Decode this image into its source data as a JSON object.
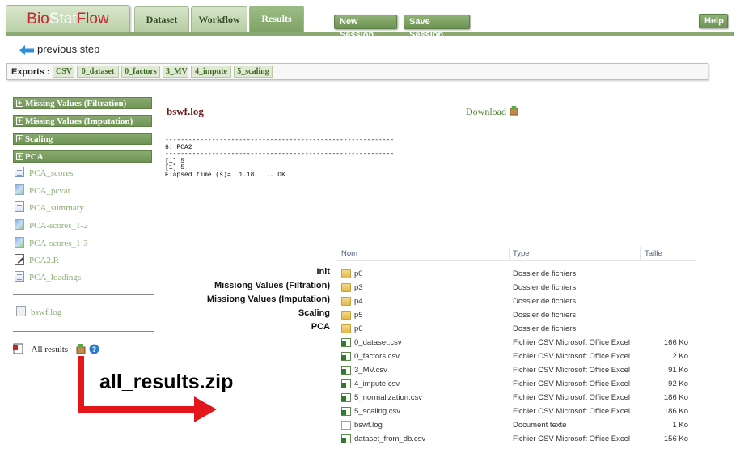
{
  "app": {
    "logo_part1": "Bio",
    "logo_part2": "Stat",
    "logo_part3": "Flow"
  },
  "tabs": {
    "dataset": "Dataset",
    "workflow": "Workflow",
    "results": "Results"
  },
  "header_buttons": {
    "new_session": "New Session",
    "save_session": "Save Session",
    "help": "Help"
  },
  "nav": {
    "previous_step": "previous step"
  },
  "exports": {
    "label": "Exports :",
    "links": [
      "CSV",
      "0_dataset",
      "0_factors",
      "3_MV",
      "4_impute",
      "5_scaling"
    ]
  },
  "sidebar": {
    "sections": [
      "Missing Values (Filtration)",
      "Missing Values (Imputation)",
      "Scaling",
      "PCA"
    ],
    "pca_items": [
      "PCA_scores",
      "PCA_pcvar",
      "PCA_summary",
      "PCA-scores_1-2",
      "PCA-scores_1-3",
      "PCA2.R",
      "PCA_loadings"
    ],
    "log_item": "bswf.log",
    "all_results": "- All results"
  },
  "content": {
    "file_title": "bswf.log",
    "download": "Download",
    "log_lines": [
      "-----------------------------------------------------------",
      "6: PCA2",
      "-----------------------------------------------------------",
      "[1] 5",
      "[1] 5",
      "Elapsed time (s)=  1.18  ... OK"
    ]
  },
  "annotation": {
    "big_label": "all_results.zip",
    "arrow_color": "#e3161b"
  },
  "step_labels": [
    "Init",
    "Missiong Values (Filtration)",
    "Missiong Values (Imputation)",
    "Scaling",
    "PCA"
  ],
  "explorer": {
    "headers": {
      "name": "Nom",
      "type": "Type",
      "size": "Taille"
    },
    "rows": [
      {
        "name": "p0",
        "type": "Dossier de fichiers",
        "size": "",
        "icon": "folder"
      },
      {
        "name": "p3",
        "type": "Dossier de fichiers",
        "size": "",
        "icon": "folder"
      },
      {
        "name": "p4",
        "type": "Dossier de fichiers",
        "size": "",
        "icon": "folder"
      },
      {
        "name": "p5",
        "type": "Dossier de fichiers",
        "size": "",
        "icon": "folder"
      },
      {
        "name": "p6",
        "type": "Dossier de fichiers",
        "size": "",
        "icon": "folder"
      },
      {
        "name": "0_dataset.csv",
        "type": "Fichier CSV Microsoft Office Excel",
        "size": "166 Ko",
        "icon": "xls"
      },
      {
        "name": "0_factors.csv",
        "type": "Fichier CSV Microsoft Office Excel",
        "size": "2 Ko",
        "icon": "xls"
      },
      {
        "name": "3_MV.csv",
        "type": "Fichier CSV Microsoft Office Excel",
        "size": "91 Ko",
        "icon": "xls"
      },
      {
        "name": "4_impute.csv",
        "type": "Fichier CSV Microsoft Office Excel",
        "size": "92 Ko",
        "icon": "xls"
      },
      {
        "name": "5_normalization.csv",
        "type": "Fichier CSV Microsoft Office Excel",
        "size": "186 Ko",
        "icon": "xls"
      },
      {
        "name": "5_scaling.csv",
        "type": "Fichier CSV Microsoft Office Excel",
        "size": "186 Ko",
        "icon": "xls"
      },
      {
        "name": "bswf.log",
        "type": "Document texte",
        "size": "1 Ko",
        "icon": "txt"
      },
      {
        "name": "dataset_from_db.csv",
        "type": "Fichier CSV Microsoft Office Excel",
        "size": "156 Ko",
        "icon": "xls"
      }
    ]
  }
}
